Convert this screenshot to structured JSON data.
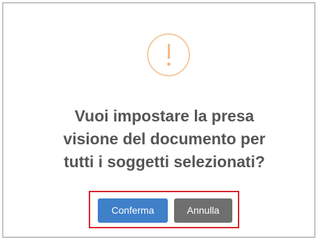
{
  "dialog": {
    "icon": "exclamation-circle-icon",
    "title_lines": [
      "Vuoi impostare la presa",
      "visione del documento per",
      "tutti i soggetti selezionati?"
    ],
    "confirm_label": "Conferma",
    "cancel_label": "Annulla"
  },
  "colors": {
    "icon_accent": "#f6b888",
    "confirm_button": "#3f80c9",
    "cancel_button": "#6f6f6f",
    "highlight_border": "#d8232a",
    "title_text": "#555555"
  }
}
